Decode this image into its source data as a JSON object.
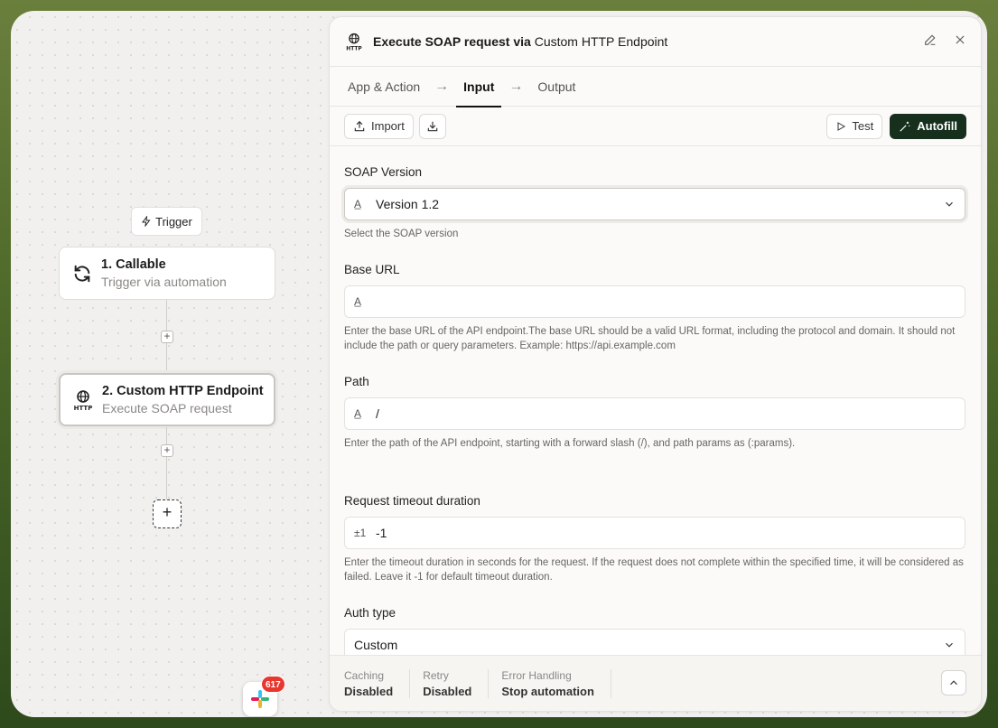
{
  "canvas": {
    "trigger_label": "Trigger",
    "nodes": [
      {
        "title": "1. Callable",
        "subtitle": "Trigger via automation",
        "icon": "refresh-icon"
      },
      {
        "title": "2. Custom HTTP Endpoint",
        "subtitle": "Execute SOAP request",
        "icon": "http-globe-icon"
      }
    ],
    "add_symbol": "+",
    "slack_badge": "617"
  },
  "panel": {
    "title_bold": "Execute SOAP request via",
    "title_rest": " Custom HTTP Endpoint",
    "tabs": [
      "App & Action",
      "Input",
      "Output"
    ],
    "active_tab": "Input",
    "toolbar": {
      "import_label": "Import",
      "test_label": "Test",
      "autofill_label": "Autofill"
    },
    "fields": {
      "soap_version": {
        "label": "SOAP Version",
        "value": "Version 1.2",
        "help": "Select the SOAP version"
      },
      "base_url": {
        "label": "Base URL",
        "value": "",
        "help": "Enter the base URL of the API endpoint.The base URL should be a valid URL format, including the protocol and domain. It should not include the path or query parameters. Example: https://api.example.com"
      },
      "path": {
        "label": "Path",
        "value": "/",
        "help": "Enter the path of the API endpoint, starting with a forward slash (/), and path params as (:params)."
      },
      "timeout": {
        "label": "Request timeout duration",
        "prefix": "±1",
        "value": "-1",
        "help": "Enter the timeout duration in seconds for the request. If the request does not complete within the specified time, it will be considered as failed. Leave it -1 for default timeout duration."
      },
      "auth_type": {
        "label": "Auth type",
        "value": "Custom"
      }
    },
    "footer": {
      "caching": {
        "key": "Caching",
        "value": "Disabled"
      },
      "retry": {
        "key": "Retry",
        "value": "Disabled"
      },
      "error_handling": {
        "key": "Error Handling",
        "value": "Stop automation"
      }
    }
  },
  "colors": {
    "accent_dark": "#16301d",
    "badge_red": "#e8372f"
  }
}
